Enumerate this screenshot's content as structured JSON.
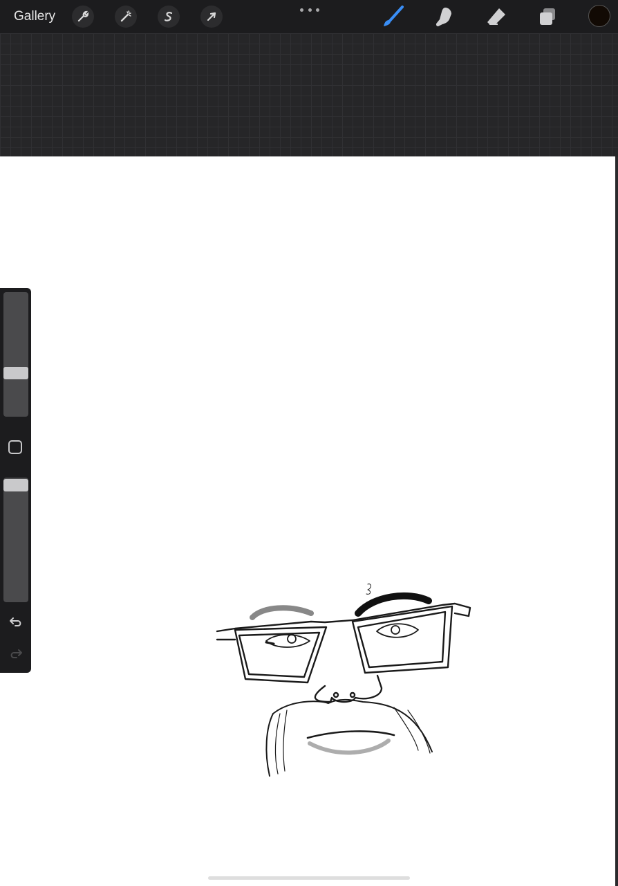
{
  "topbar": {
    "gallery_label": "Gallery",
    "left_tools": [
      {
        "name": "actions",
        "icon": "wrench-icon"
      },
      {
        "name": "adjustments",
        "icon": "magic-wand-icon"
      },
      {
        "name": "selection",
        "icon": "selection-s-icon"
      },
      {
        "name": "transform",
        "icon": "arrow-cursor-icon"
      }
    ],
    "more_menu_icon": "ellipsis-icon",
    "right_tools": [
      {
        "name": "brush",
        "icon": "brush-icon",
        "active": true
      },
      {
        "name": "smudge",
        "icon": "smudge-finger-icon",
        "active": false
      },
      {
        "name": "eraser",
        "icon": "eraser-icon",
        "active": false
      },
      {
        "name": "layers",
        "icon": "layers-icon",
        "active": false
      }
    ],
    "current_color": "#120a04"
  },
  "sidebar": {
    "brush_size_level": 0.4,
    "opacity_level": 0.92,
    "modify_button_icon": "square-icon",
    "undo_icon": "undo-icon",
    "redo_icon": "redo-icon"
  },
  "colors": {
    "toolbar_bg": "#1c1c1e",
    "active_tool": "#3a8ef6",
    "canvas": "#ffffff"
  }
}
